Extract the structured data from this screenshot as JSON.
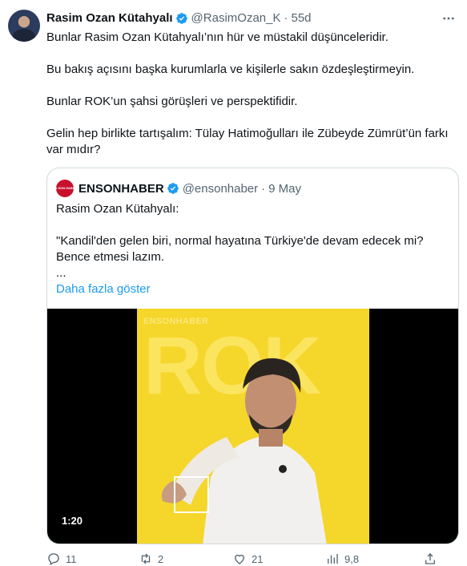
{
  "author": {
    "name": "Rasim Ozan Kütahyalı",
    "handle": "@RasimOzan_K",
    "separator": "·",
    "time": "55d"
  },
  "body": {
    "lines": [
      "Bunlar Rasim Ozan Kütahyalı’nın hür ve müstakil düşünceleridir.",
      "Bu bakış açısını başka kurumlarla ve kişilerle sakın özdeşleştirmeyin.",
      "Bunlar ROK’un şahsi görüşleri ve perspektifidir.",
      "Gelin hep birlikte tartışalım: Tülay Hatimoğulları ile Zübeyde Zümrüt’ün farkı var mıdır?"
    ]
  },
  "quote": {
    "logo_text": "EN SON HABER",
    "name": "ENSONHABER",
    "handle": "@ensonhaber",
    "separator": "·",
    "date": "9 May",
    "line1": "Rasim Ozan Kütahyalı:",
    "line2": "\"Kandil'den gelen biri, normal hayatına Türkiye'de devam edecek mi?",
    "line3": "Bence etmesi lazım.",
    "line4": "...",
    "show_more": "Daha fazla göster",
    "media": {
      "brand": "ENSONHABER",
      "big_text": "ROK",
      "duration": "1:20",
      "background_color": "#f5d62a"
    }
  },
  "actions": {
    "replies": "11",
    "retweets": "2",
    "likes": "21",
    "views": "9,8"
  },
  "colors": {
    "accent": "#1d9bf0",
    "secondary_text": "#536471"
  }
}
